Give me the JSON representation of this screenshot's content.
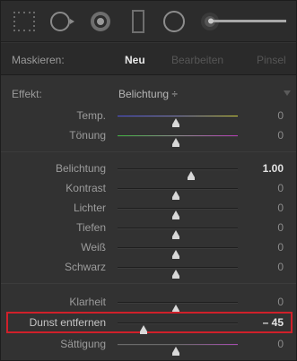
{
  "toolbar": {
    "icons": [
      "grid-dots-icon",
      "circle-with-arrow-icon",
      "radial-target-icon",
      "rectangle-icon",
      "circle-outline-icon",
      "brush-slider-icon"
    ]
  },
  "mask": {
    "label": "Maskieren:",
    "tabs": [
      {
        "label": "Neu",
        "active": true
      },
      {
        "label": "Bearbeiten",
        "active": false
      },
      {
        "label": "Pinsel",
        "active": false
      }
    ]
  },
  "effect": {
    "label": "Effekt:",
    "value": "Belichtung ÷"
  },
  "sliders": {
    "temp": {
      "label": "Temp.",
      "value": "0"
    },
    "tint": {
      "label": "Tönung",
      "value": "0"
    },
    "exposure": {
      "label": "Belichtung",
      "value": "1.00"
    },
    "contrast": {
      "label": "Kontrast",
      "value": "0"
    },
    "highlights": {
      "label": "Lichter",
      "value": "0"
    },
    "shadows": {
      "label": "Tiefen",
      "value": "0"
    },
    "whites": {
      "label": "Weiß",
      "value": "0"
    },
    "blacks": {
      "label": "Schwarz",
      "value": "0"
    },
    "clarity": {
      "label": "Klarheit",
      "value": "0"
    },
    "dehaze": {
      "label": "Dunst entfernen",
      "value": "– 45"
    },
    "saturation": {
      "label": "Sättigung",
      "value": "0"
    }
  },
  "colors": {
    "highlight_border": "#d0202a",
    "temp_left": "#4a4fd8",
    "temp_right": "#c8c83a",
    "tint_left": "#3fae3f",
    "tint_right": "#b23cb2"
  }
}
